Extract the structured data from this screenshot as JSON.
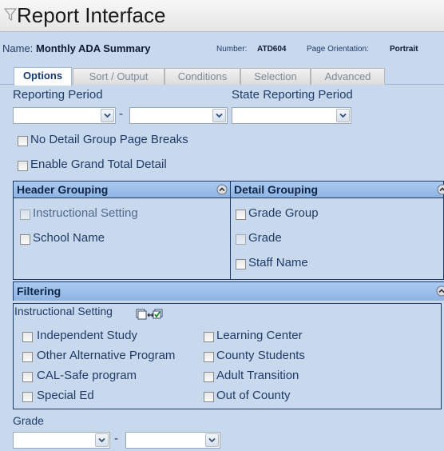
{
  "window": {
    "title": "Report Interface",
    "icon": "funnel-icon"
  },
  "report": {
    "name_label": "Name:",
    "name_value": "Monthly ADA Summary",
    "number_label": "Number:",
    "number_value": "ATD604",
    "orientation_label": "Page Orientation:",
    "orientation_value": "Portrait"
  },
  "tabs": [
    {
      "label": "Options",
      "active": true
    },
    {
      "label": "Sort / Output",
      "active": false
    },
    {
      "label": "Conditions",
      "active": false
    },
    {
      "label": "Selection",
      "active": false
    },
    {
      "label": "Advanced",
      "active": false
    }
  ],
  "options": {
    "reporting_period_label": "Reporting Period",
    "reporting_period_from": "",
    "reporting_period_to": "",
    "range_separator": "-",
    "state_reporting_period_label": "State Reporting Period",
    "state_reporting_period_value": "",
    "no_detail_page_breaks_label": "No Detail Group Page Breaks",
    "no_detail_page_breaks_checked": false,
    "enable_grand_total_label": "Enable Grand Total Detail",
    "enable_grand_total_checked": false
  },
  "header_grouping": {
    "title": "Header Grouping",
    "items": [
      {
        "label": "Instructional Setting",
        "checked": false,
        "disabled": true
      },
      {
        "label": "School Name",
        "checked": false,
        "disabled": false
      }
    ]
  },
  "detail_grouping": {
    "title": "Detail Grouping",
    "items": [
      {
        "label": "Grade Group",
        "checked": false,
        "disabled": false
      },
      {
        "label": "Grade",
        "checked": false,
        "disabled": true
      },
      {
        "label": "Staff Name",
        "checked": false,
        "disabled": false
      }
    ]
  },
  "filtering": {
    "title": "Filtering",
    "instructional_setting_label": "Instructional Setting",
    "toggle_icon": "select-toggle-icon",
    "left_options": [
      {
        "label": "Independent Study",
        "checked": false
      },
      {
        "label": "Other Alternative Program",
        "checked": false
      },
      {
        "label": "CAL-Safe program",
        "checked": false
      },
      {
        "label": "Special Ed",
        "checked": false
      }
    ],
    "right_options": [
      {
        "label": "Learning Center",
        "checked": false
      },
      {
        "label": "County Students",
        "checked": false
      },
      {
        "label": "Adult Transition",
        "checked": false
      },
      {
        "label": "Out of County",
        "checked": false
      }
    ],
    "grade_label": "Grade",
    "grade_from": "",
    "grade_to": ""
  },
  "colors": {
    "background": "#c8d9ee",
    "panel_header": "#9bc0ec",
    "border": "#1e3a63",
    "text": "#1f3b66"
  }
}
